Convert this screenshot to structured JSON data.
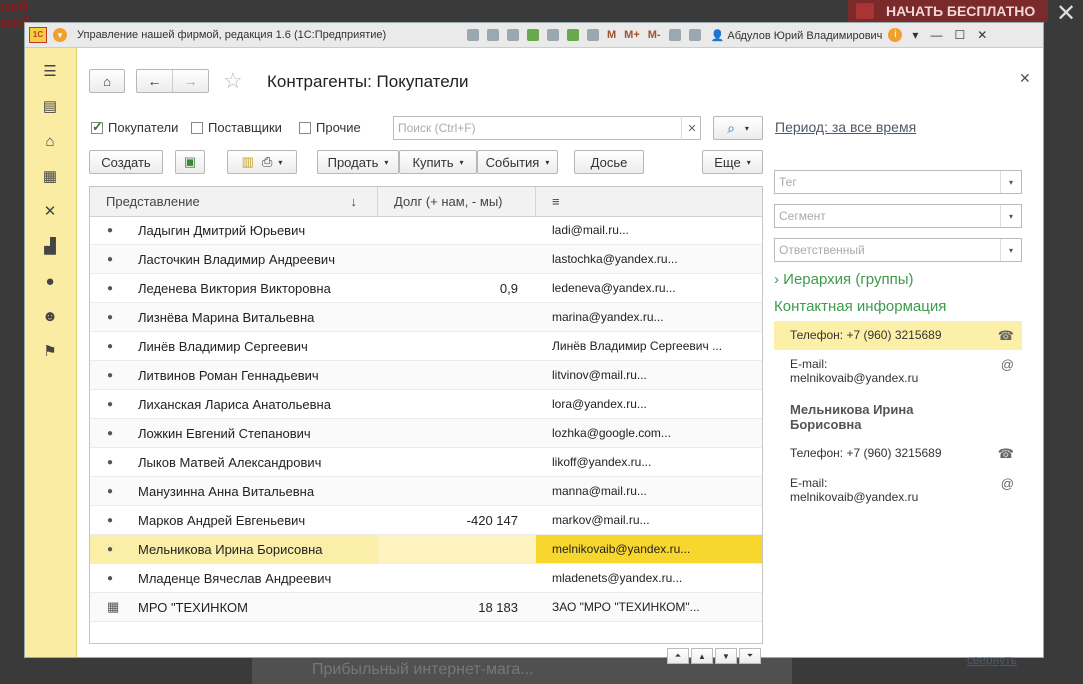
{
  "background": {
    "top_left_text": "ней\nмой",
    "cta": "НАЧАТЬ БЕСПЛАТНО",
    "bottom_text": "Прибыльный интернет-мага..."
  },
  "window": {
    "title": "Управление нашей фирмой, редакция 1.6  (1С:Предприятие)",
    "m_buttons": [
      "M",
      "M+",
      "M-"
    ],
    "user": "Абдулов Юрий Владимирович"
  },
  "page": {
    "title": "Контрагенты: Покупатели"
  },
  "filters": [
    {
      "label": "Покупатели",
      "checked": true
    },
    {
      "label": "Поставщики",
      "checked": false
    },
    {
      "label": "Прочие",
      "checked": false
    }
  ],
  "search": {
    "placeholder": "Поиск (Ctrl+F)"
  },
  "toolbar": {
    "create": "Создать",
    "sell": "Продать",
    "buy": "Купить",
    "events": "События",
    "dossier": "Досье",
    "more": "Еще"
  },
  "right_panel": {
    "period": "Период: за все время",
    "tag_placeholder": "Тег",
    "segment_placeholder": "Сегмент",
    "responsible_placeholder": "Ответственный",
    "hierarchy": "Иерархия (группы)",
    "contact_info": "Контактная информация",
    "contacts": [
      {
        "text": "Телефон: +7 (960) 3215689",
        "icon": "phone-icon"
      },
      {
        "line1": "E-mail:",
        "line2": "melnikovaib@yandex.ru",
        "icon": "at-icon"
      },
      {
        "name1": "Мельникова Ирина",
        "name2": "Борисовна"
      },
      {
        "text": "Телефон: +7 (960) 3215689",
        "icon": "phone-icon"
      },
      {
        "line1": "E-mail:",
        "line2": "melnikovaib@yandex.ru",
        "icon": "at-icon"
      }
    ],
    "collapse": "свернуть"
  },
  "table": {
    "headers": [
      "Представление",
      "Долг (+ нам, - мы)",
      "≡"
    ],
    "sort_indicator": "↓",
    "rows": [
      {
        "name": "Ладыгин Дмитрий Юрьевич",
        "debt": "",
        "contact": "ladi@mail.ru..."
      },
      {
        "name": "Ласточкин Владимир Андреевич",
        "debt": "",
        "contact": "lastochka@yandex.ru..."
      },
      {
        "name": "Леденева Виктория Викторовна",
        "debt": "0,9",
        "contact": "ledeneva@yandex.ru..."
      },
      {
        "name": "Лизнёва Марина Витальевна",
        "debt": "",
        "contact": "marina@yandex.ru..."
      },
      {
        "name": "Линёв Владимир Сергеевич",
        "debt": "",
        "contact": "Линёв Владимир Сергеевич ..."
      },
      {
        "name": "Литвинов Роман Геннадьевич",
        "debt": "",
        "contact": "litvinov@mail.ru..."
      },
      {
        "name": "Лиханская Лариса Анатольевна",
        "debt": "",
        "contact": "lora@yandex.ru..."
      },
      {
        "name": "Ложкин Евгений Степанович",
        "debt": "",
        "contact": "lozhka@google.com..."
      },
      {
        "name": "Лыков Матвей Александрович",
        "debt": "",
        "contact": "likoff@yandex.ru..."
      },
      {
        "name": "Манузинна Анна Витальевна",
        "debt": "",
        "contact": "manna@mail.ru..."
      },
      {
        "name": "Марков Андрей Евгеньевич",
        "debt": "-420 147",
        "contact": "markov@mail.ru..."
      },
      {
        "name": "Мельникова Ирина Борисовна",
        "debt": "",
        "contact": "melnikovaib@yandex.ru..."
      },
      {
        "name": "Младенце Вячеслав Андреевич",
        "debt": "",
        "contact": "mladenets@yandex.ru..."
      },
      {
        "name": "МРО \"ТЕХИНКОМ",
        "debt": "18 183",
        "contact": "ЗАО \"МРО \"ТЕХИНКОМ\"..."
      }
    ]
  },
  "colors": {
    "sidebar": "#fbeca4",
    "selected_row": "#fbeea8",
    "selected_cell": "#f7d72e",
    "section_green": "#3d9b4b"
  }
}
